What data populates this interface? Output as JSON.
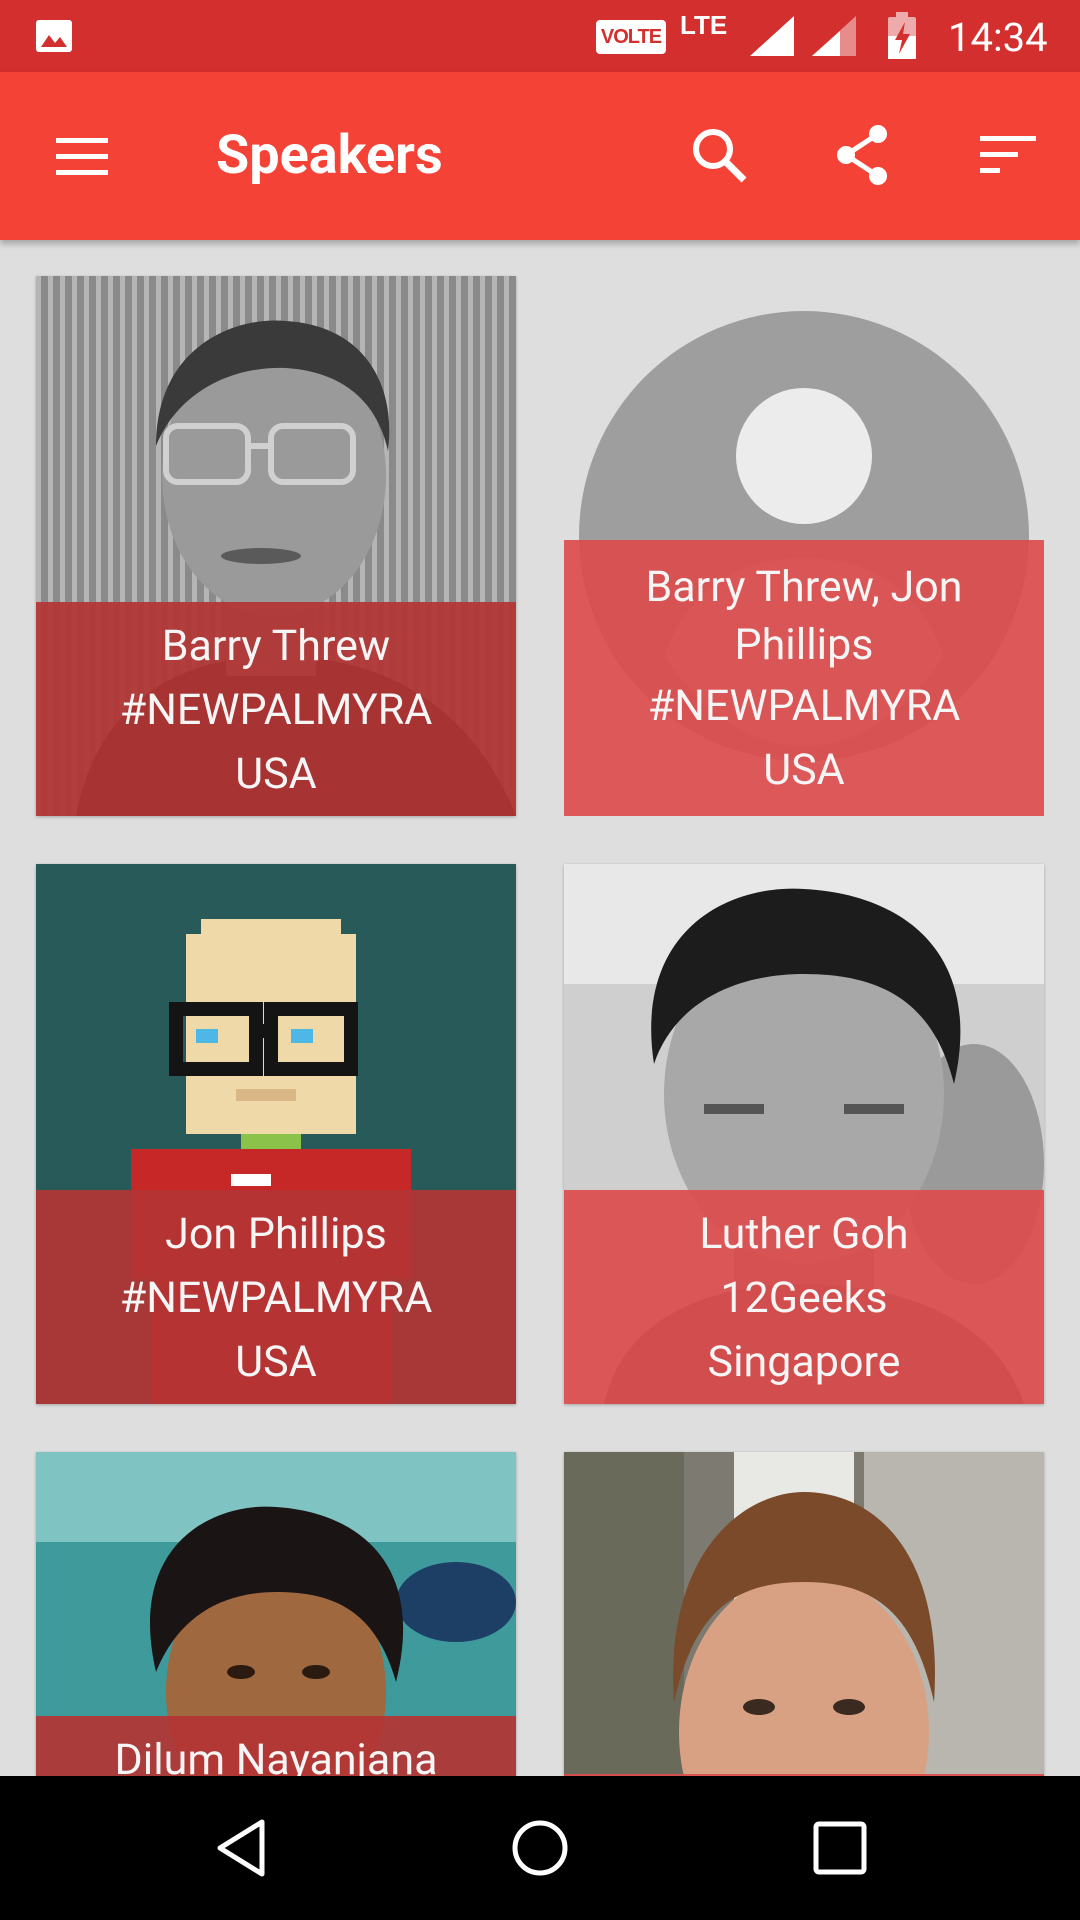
{
  "status_bar": {
    "volte": "VOLTE",
    "network": "LTE",
    "time": "14:34"
  },
  "app_bar": {
    "title": "Speakers"
  },
  "colors": {
    "status_bar": "#d32f2f",
    "app_bar": "#f44336",
    "caption_dark": "#b33a3a",
    "caption_light": "#dc5252"
  },
  "speakers": [
    {
      "name": "Barry Threw",
      "org": "#NEWPALMYRA",
      "country": "USA"
    },
    {
      "name_line1": "Barry Threw, Jon",
      "name_line2": "Phillips",
      "org": "#NEWPALMYRA",
      "country": "USA"
    },
    {
      "name": "Jon Phillips",
      "org": "#NEWPALMYRA",
      "country": "USA"
    },
    {
      "name": "Luther Goh",
      "org": "12Geeks",
      "country": "Singapore"
    },
    {
      "name": "Dilum Nayanjana"
    },
    {
      "name": ""
    }
  ],
  "nav_bar": {
    "back": "back-icon",
    "home": "home-icon",
    "recents": "recents-icon"
  }
}
